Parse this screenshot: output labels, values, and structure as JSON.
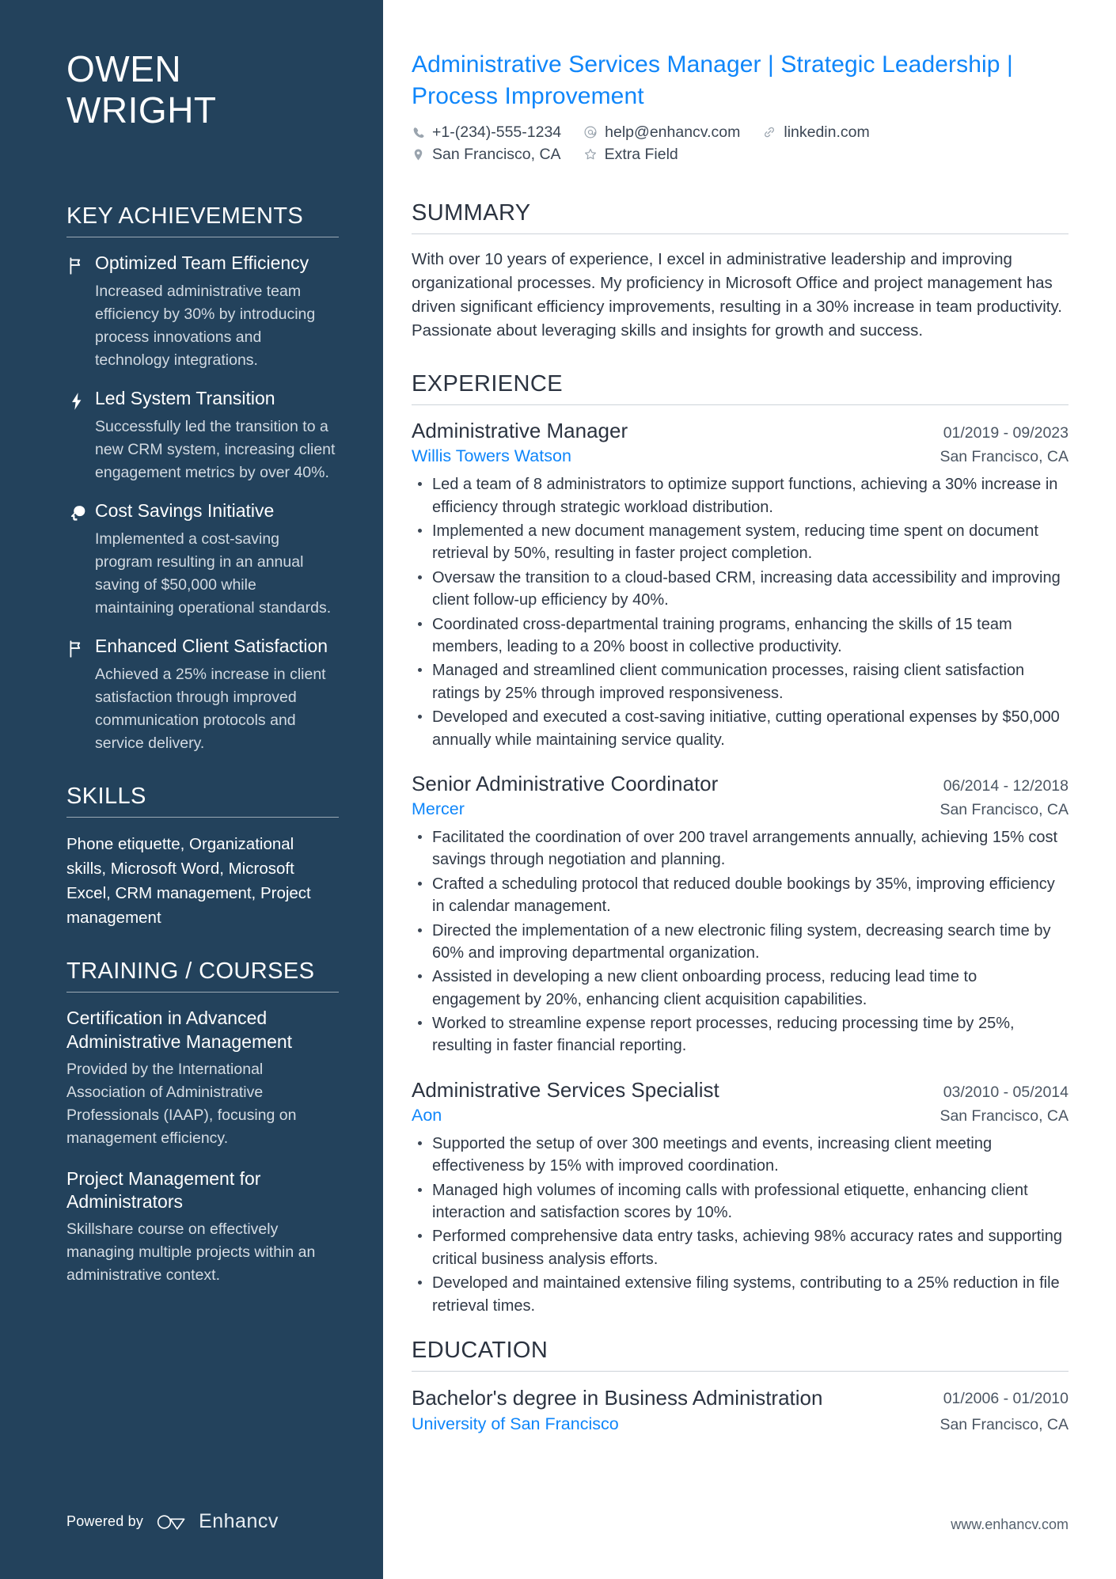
{
  "sidebar": {
    "name_lines": [
      "OWEN",
      "WRIGHT"
    ],
    "key_achievements": {
      "heading": "KEY ACHIEVEMENTS",
      "items": [
        {
          "icon": "flag-icon",
          "title": "Optimized Team Efficiency",
          "description": "Increased administrative team efficiency by 30% by introducing process innovations and technology integrations."
        },
        {
          "icon": "lightning-bolt-icon",
          "title": "Led System Transition",
          "description": "Successfully led the transition to a new CRM system, increasing client engagement metrics by over 40%."
        },
        {
          "icon": "idea-head-icon",
          "title": "Cost Savings Initiative",
          "description": "Implemented a cost-saving program resulting in an annual saving of $50,000 while maintaining operational standards."
        },
        {
          "icon": "flag-icon",
          "title": "Enhanced Client Satisfaction",
          "description": "Achieved a 25% increase in client satisfaction through improved communication protocols and service delivery."
        }
      ]
    },
    "skills": {
      "heading": "SKILLS",
      "text": "Phone etiquette, Organizational skills, Microsoft Word, Microsoft Excel, CRM management, Project management"
    },
    "training": {
      "heading": "TRAINING / COURSES",
      "items": [
        {
          "title": "Certification in Advanced Administrative Management",
          "description": "Provided by the International Association of Administrative Professionals (IAAP), focusing on management efficiency."
        },
        {
          "title": "Project Management for Administrators",
          "description": "Skillshare course on effectively managing multiple projects within an administrative context."
        }
      ]
    },
    "footer": {
      "powered_by": "Powered by",
      "brand": "Enhancv"
    }
  },
  "main": {
    "headline": "Administrative Services Manager | Strategic Leadership | Process Improvement",
    "contact": {
      "row1": [
        {
          "icon": "phone-icon",
          "text": "+1-(234)-555-1234"
        },
        {
          "icon": "email-at-icon",
          "text": "help@enhancv.com"
        },
        {
          "icon": "link-icon",
          "text": "linkedin.com"
        }
      ],
      "row2": [
        {
          "icon": "location-pin-icon",
          "text": "San Francisco, CA"
        },
        {
          "icon": "star-icon",
          "text": "Extra Field"
        }
      ]
    },
    "summary": {
      "heading": "SUMMARY",
      "text": "With over 10 years of experience, I excel in administrative leadership and improving organizational processes. My proficiency in Microsoft Office and project management has driven significant efficiency improvements, resulting in a 30% increase in team productivity. Passionate about leveraging skills and insights for growth and success."
    },
    "experience": {
      "heading": "EXPERIENCE",
      "jobs": [
        {
          "title": "Administrative Manager",
          "dates": "01/2019 - 09/2023",
          "company": "Willis Towers Watson",
          "location": "San Francisco, CA",
          "bullets": [
            "Led a team of 8 administrators to optimize support functions, achieving a 30% increase in efficiency through strategic workload distribution.",
            "Implemented a new document management system, reducing time spent on document retrieval by 50%, resulting in faster project completion.",
            "Oversaw the transition to a cloud-based CRM, increasing data accessibility and improving client follow-up efficiency by 40%.",
            "Coordinated cross-departmental training programs, enhancing the skills of 15 team members, leading to a 20% boost in collective productivity.",
            "Managed and streamlined client communication processes, raising client satisfaction ratings by 25% through improved responsiveness.",
            "Developed and executed a cost-saving initiative, cutting operational expenses by $50,000 annually while maintaining service quality."
          ]
        },
        {
          "title": "Senior Administrative Coordinator",
          "dates": "06/2014 - 12/2018",
          "company": "Mercer",
          "location": "San Francisco, CA",
          "bullets": [
            "Facilitated the coordination of over 200 travel arrangements annually, achieving 15% cost savings through negotiation and planning.",
            "Crafted a scheduling protocol that reduced double bookings by 35%, improving efficiency in calendar management.",
            "Directed the implementation of a new electronic filing system, decreasing search time by 60% and improving departmental organization.",
            "Assisted in developing a new client onboarding process, reducing lead time to engagement by 20%, enhancing client acquisition capabilities.",
            "Worked to streamline expense report processes, reducing processing time by 25%, resulting in faster financial reporting."
          ]
        },
        {
          "title": "Administrative Services Specialist",
          "dates": "03/2010 - 05/2014",
          "company": "Aon",
          "location": "San Francisco, CA",
          "bullets": [
            "Supported the setup of over 300 meetings and events, increasing client meeting effectiveness by 15% with improved coordination.",
            "Managed high volumes of incoming calls with professional etiquette, enhancing client interaction and satisfaction scores by 10%.",
            "Performed comprehensive data entry tasks, achieving 98% accuracy rates and supporting critical business analysis efforts.",
            "Developed and maintained extensive filing systems, contributing to a 25% reduction in file retrieval times."
          ]
        }
      ]
    },
    "education": {
      "heading": "EDUCATION",
      "items": [
        {
          "degree": "Bachelor's degree in Business Administration",
          "dates": "01/2006 - 01/2010",
          "school": "University of San Francisco",
          "location": "San Francisco, CA"
        }
      ]
    },
    "footer_url": "www.enhancv.com"
  },
  "colors": {
    "sidebar_bg": "#23425c",
    "accent_blue": "#0f86fa",
    "body_text": "#2f3845"
  }
}
